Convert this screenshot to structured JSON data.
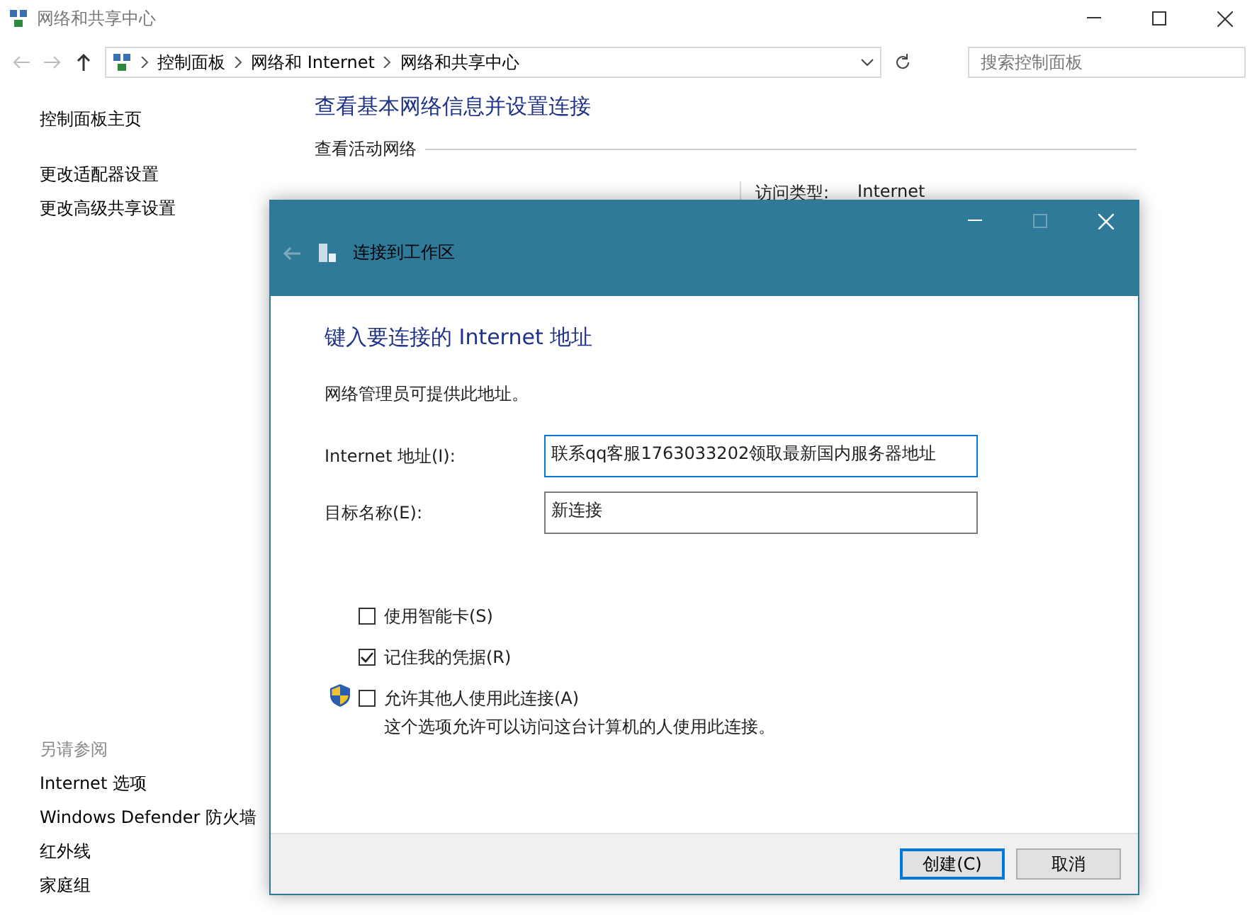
{
  "window": {
    "title": "网络和共享中心"
  },
  "address_bar": {
    "breadcrumb": [
      "控制面板",
      "网络和 Internet",
      "网络和共享中心"
    ],
    "search_placeholder": "搜索控制面板"
  },
  "sidebar": {
    "items": [
      "控制面板主页",
      "更改适配器设置",
      "更改高级共享设置"
    ],
    "see_also": {
      "heading": "另请参阅",
      "items": [
        "Internet 选项",
        "Windows Defender 防火墙",
        "红外线",
        "家庭组"
      ]
    }
  },
  "main": {
    "heading": "查看基本网络信息并设置连接",
    "section": "查看活动网络",
    "access_label": "访问类型:",
    "access_value": "Internet"
  },
  "dialog": {
    "title": "连接到工作区",
    "heading": "键入要连接的 Internet 地址",
    "note": "网络管理员可提供此地址。",
    "fields": [
      {
        "label": "Internet 地址(I):",
        "value": "联系qq客服1763033202领取最新国内服务器地址",
        "focused": true
      },
      {
        "label": "目标名称(E):",
        "value": "新连接",
        "focused": false
      }
    ],
    "options": [
      {
        "label": "使用智能卡(S)",
        "checked": false,
        "shield": false
      },
      {
        "label": "记住我的凭据(R)",
        "checked": true,
        "shield": false
      },
      {
        "label": "允许其他人使用此连接(A)",
        "checked": false,
        "shield": true,
        "description": "这个选项允许可以访问这台计算机的人使用此连接。"
      }
    ],
    "buttons": [
      {
        "label": "创建(C)",
        "default": true
      },
      {
        "label": "取消",
        "default": false
      }
    ]
  }
}
